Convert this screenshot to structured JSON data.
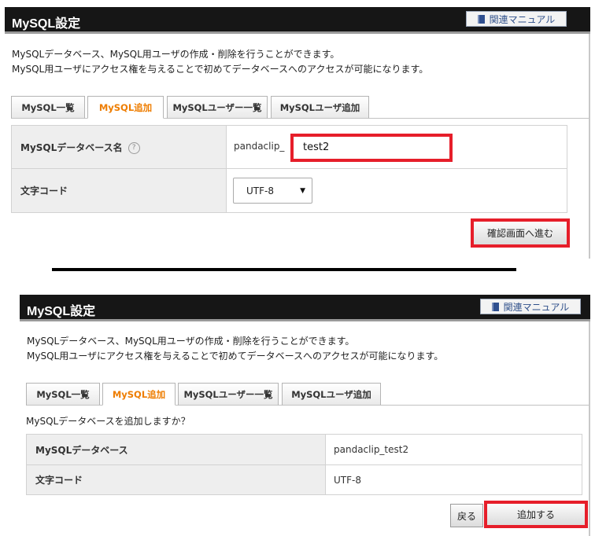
{
  "panel1": {
    "title": "MySQL設定",
    "manual_button": "関連マニュアル",
    "description_line1": "MySQLデータベース、MySQL用ユーザの作成・削除を行うことができます。",
    "description_line2": "MySQL用ユーザにアクセス権を与えることで初めてデータベースへのアクセスが可能になります。",
    "tabs": [
      {
        "label": "MySQL一覧",
        "active": false
      },
      {
        "label": "MySQL追加",
        "active": true
      },
      {
        "label": "MySQLユーザー一覧",
        "active": false
      },
      {
        "label": "MySQLユーザ追加",
        "active": false
      }
    ],
    "form": {
      "db_name_label": "MySQLデータベース名",
      "help_icon": "?",
      "db_prefix": "pandaclip_",
      "db_name_value": "test2",
      "charset_label": "文字コード",
      "charset_value": "UTF-8"
    },
    "next_button": "確認画面へ進む"
  },
  "panel2": {
    "title": "MySQL設定",
    "manual_button": "関連マニュアル",
    "description_line1": "MySQLデータベース、MySQL用ユーザの作成・削除を行うことができます。",
    "description_line2": "MySQL用ユーザにアクセス権を与えることで初めてデータベースへのアクセスが可能になります。",
    "tabs": [
      {
        "label": "MySQL一覧",
        "active": false
      },
      {
        "label": "MySQL追加",
        "active": true
      },
      {
        "label": "MySQLユーザー一覧",
        "active": false
      },
      {
        "label": "MySQLユーザ追加",
        "active": false
      }
    ],
    "confirm_message": "MySQLデータベースを追加しますか？",
    "confirm_table": [
      {
        "label": "MySQLデータベース",
        "value": "pandaclip_test2"
      },
      {
        "label": "文字コード",
        "value": "UTF-8"
      }
    ],
    "back_button": "戻る",
    "add_button": "追加する"
  },
  "colors": {
    "title_bar": "#161616",
    "active_tab_text": "#ee7d00",
    "highlight_frame": "#e61e2a",
    "manual_link": "#2e4f8a"
  },
  "icons": {
    "manual": "book-icon",
    "help": "question-circle-icon",
    "select": "caret-down-icon"
  }
}
